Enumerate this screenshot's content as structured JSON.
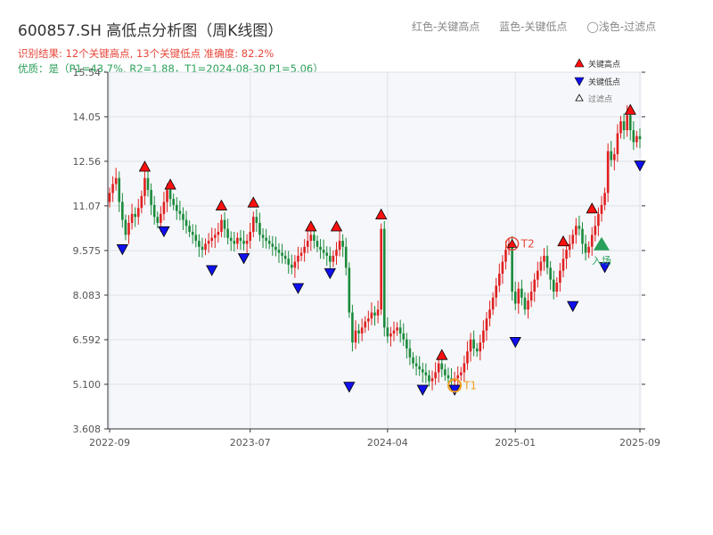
{
  "title": "600857.SH 高低点分析图（周K线图）",
  "header_legend": {
    "red": "红色-关键高点",
    "blue": "蓝色-关键低点",
    "light": "◯浅色-过滤点"
  },
  "subtitle_result": "识别结果: 12个关键高点, 13个关键低点  准确度: 82.2%",
  "subtitle_quality": "优质：是（P1=43.7%, R2=1.88，T1=2024-08-30 P1=5.06）",
  "legend": {
    "high": "关键高点",
    "low": "关键低点",
    "filtered": "过滤点"
  },
  "annotations": {
    "t1": "T1",
    "t2": "T2",
    "entry": "入场"
  },
  "colors": {
    "up": "#e02020",
    "down": "#1a8a3a",
    "high": "#ff1010",
    "low": "#1010ee",
    "bg": "#f5f7fa",
    "grid": "#dde2ea"
  },
  "chart_data": {
    "type": "candlestick",
    "yticks": [
      "3.608",
      "5.100",
      "6.592",
      "8.083",
      "9.575",
      "11.07",
      "12.56",
      "14.05",
      "15.54"
    ],
    "ylim": [
      3.608,
      15.54
    ],
    "xticks": [
      "2022-09",
      "2023-07",
      "2024-04",
      "2025-01",
      "2025-09"
    ],
    "series_close": [
      11.5,
      11.8,
      12.0,
      11.2,
      10.6,
      10.1,
      10.5,
      10.8,
      10.7,
      11.0,
      11.4,
      12.0,
      11.6,
      11.1,
      10.7,
      10.5,
      10.8,
      11.2,
      11.6,
      11.3,
      11.1,
      10.9,
      10.8,
      10.6,
      10.4,
      10.2,
      10.1,
      9.9,
      9.7,
      9.6,
      9.8,
      9.9,
      10.0,
      10.1,
      10.2,
      10.6,
      10.3,
      10.0,
      9.9,
      9.8,
      10.0,
      9.9,
      9.8,
      9.9,
      10.2,
      10.7,
      10.5,
      10.1,
      10.0,
      9.9,
      9.8,
      9.7,
      9.6,
      9.5,
      9.4,
      9.3,
      9.1,
      9.0,
      9.2,
      9.4,
      9.5,
      9.7,
      9.9,
      10.1,
      9.9,
      9.7,
      9.6,
      9.5,
      9.4,
      9.2,
      9.4,
      9.6,
      9.9,
      9.7,
      9.0,
      7.5,
      6.5,
      6.9,
      6.8,
      7.0,
      7.2,
      7.3,
      7.5,
      7.4,
      7.6,
      10.3,
      7.0,
      6.7,
      6.8,
      6.9,
      7.0,
      6.8,
      6.6,
      6.3,
      6.0,
      5.8,
      5.7,
      5.6,
      5.5,
      5.4,
      5.2,
      5.3,
      5.5,
      5.8,
      5.6,
      5.4,
      5.3,
      5.2,
      5.3,
      5.4,
      5.5,
      5.8,
      6.2,
      6.6,
      6.3,
      6.2,
      6.5,
      6.9,
      7.3,
      7.6,
      8.0,
      8.4,
      8.8,
      9.2,
      9.6,
      9.8,
      8.2,
      7.8,
      8.3,
      8.0,
      7.6,
      7.9,
      8.2,
      8.6,
      8.9,
      9.2,
      9.4,
      9.0,
      8.6,
      8.2,
      8.5,
      8.9,
      9.3,
      9.6,
      9.8,
      10.1,
      10.4,
      10.3,
      9.8,
      9.5,
      9.7,
      10.1,
      10.4,
      10.8,
      11.1,
      11.5,
      12.9,
      12.6,
      12.8,
      13.5,
      13.9,
      13.6,
      14.1,
      13.6,
      13.2,
      13.4,
      13.3
    ],
    "key_highs": [
      {
        "i": 11,
        "v": 12.2
      },
      {
        "i": 19,
        "v": 11.6
      },
      {
        "i": 35,
        "v": 10.9
      },
      {
        "i": 45,
        "v": 11.0
      },
      {
        "i": 63,
        "v": 10.2
      },
      {
        "i": 71,
        "v": 10.2
      },
      {
        "i": 85,
        "v": 10.6
      },
      {
        "i": 104,
        "v": 5.9
      },
      {
        "i": 142,
        "v": 9.7
      },
      {
        "i": 151,
        "v": 10.8
      },
      {
        "i": 163,
        "v": 14.1
      }
    ],
    "key_lows": [
      {
        "i": 4,
        "v": 9.8
      },
      {
        "i": 17,
        "v": 10.4
      },
      {
        "i": 32,
        "v": 9.1
      },
      {
        "i": 42,
        "v": 9.5
      },
      {
        "i": 59,
        "v": 8.5
      },
      {
        "i": 69,
        "v": 9.0
      },
      {
        "i": 75,
        "v": 5.2
      },
      {
        "i": 98,
        "v": 5.1
      },
      {
        "i": 108,
        "v": 5.1
      },
      {
        "i": 127,
        "v": 6.7
      },
      {
        "i": 145,
        "v": 7.9
      },
      {
        "i": 155,
        "v": 9.2
      },
      {
        "i": 166,
        "v": 12.6
      }
    ],
    "t1": {
      "i": 108,
      "v": 5.06
    },
    "t2": {
      "i": 126,
      "v": 9.8
    },
    "entry": {
      "i": 154,
      "v": 9.7
    }
  }
}
